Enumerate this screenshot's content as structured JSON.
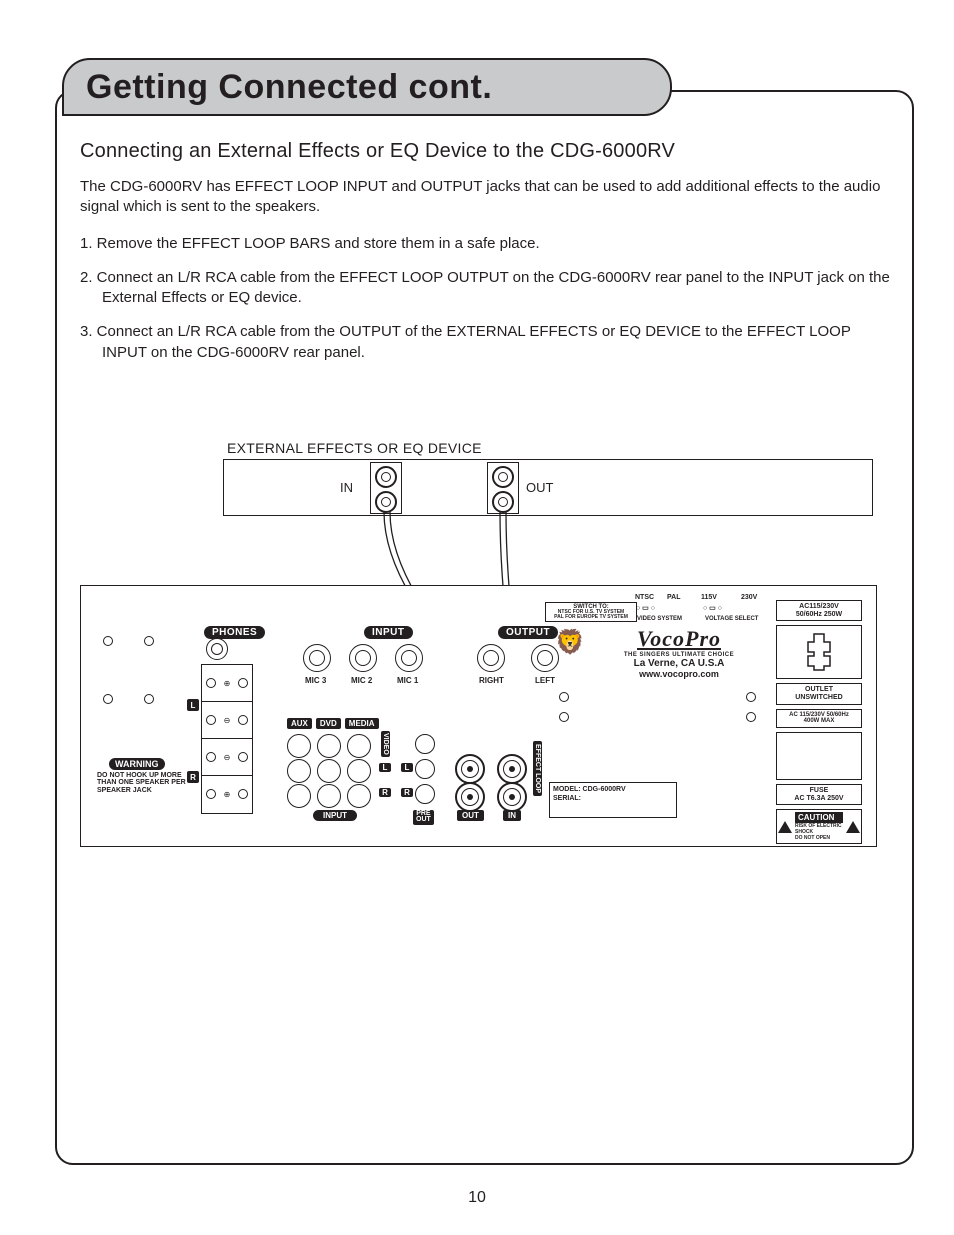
{
  "title": "Getting Connected cont.",
  "subheading": "Connecting an External Effects or EQ Device to the CDG-6000RV",
  "intro": "The CDG-6000RV has EFFECT LOOP INPUT and OUTPUT jacks that can be used to add additional effects to the audio signal which is sent to the speakers.",
  "steps": [
    "1. Remove the EFFECT LOOP BARS and store them in a safe place.",
    "2. Connect an L/R RCA cable from the EFFECT LOOP OUTPUT on the CDG-6000RV rear panel to the INPUT jack on the External Effects or EQ device.",
    "3. Connect an L/R RCA cable from the OUTPUT of the EXTERNAL EFFECTS or EQ DEVICE to the EFFECT LOOP INPUT on the CDG-6000RV rear panel."
  ],
  "page_number": "10",
  "diagram": {
    "ext_device_label": "EXTERNAL EFFECTS OR EQ DEVICE",
    "in": "IN",
    "out": "OUT"
  },
  "panel": {
    "phones": "PHONES",
    "input": "INPUT",
    "output": "OUTPUT",
    "mic3": "MIC 3",
    "mic2": "MIC 2",
    "mic1": "MIC 1",
    "right": "RIGHT",
    "left": "LEFT",
    "aux": "AUX",
    "dvd": "DVD",
    "media": "MEDIA",
    "video": "VIDEO",
    "l": "L",
    "r": "R",
    "input_bottom": "INPUT",
    "pre_out": "PRE\nOUT",
    "out_lbl": "OUT",
    "in_lbl": "IN",
    "effect_loop": "EFFECT LOOP",
    "warning": "WARNING",
    "warning_text": "DO NOT HOOK UP MORE THAN ONE SPEAKER PER SPEAKER JACK",
    "switch_to_top": "SWITCH TO:",
    "switch_to": "NTSC FOR U.S. TV SYSTEM\nPAL FOR EUROPE TV SYSTEM",
    "ntsc": "NTSC",
    "pal": "PAL",
    "video_system": "VIDEO SYSTEM",
    "v115": "115V",
    "v230": "230V",
    "voltage_select": "VOLTAGE SELECT",
    "logo": "VocoPro",
    "tagline": "THE SINGERS ULTIMATE CHOICE",
    "address": "La Verne, CA U.S.A",
    "website": "www.vocopro.com",
    "model_label": "MODEL: CDG-6000RV",
    "serial_label": "SERIAL:",
    "power_rating": "AC115/230V\n50/60Hz 250W",
    "outlet_label": "OUTLET\nUNSWITCHED",
    "outlet_rating": "AC 115/230V 50/60Hz\n400W MAX",
    "fuse": "FUSE\nAC T6.3A 250V",
    "caution": "CAUTION",
    "caution_sub": "RISK OF ELECTRIC SHOCK\nDO NOT OPEN"
  }
}
